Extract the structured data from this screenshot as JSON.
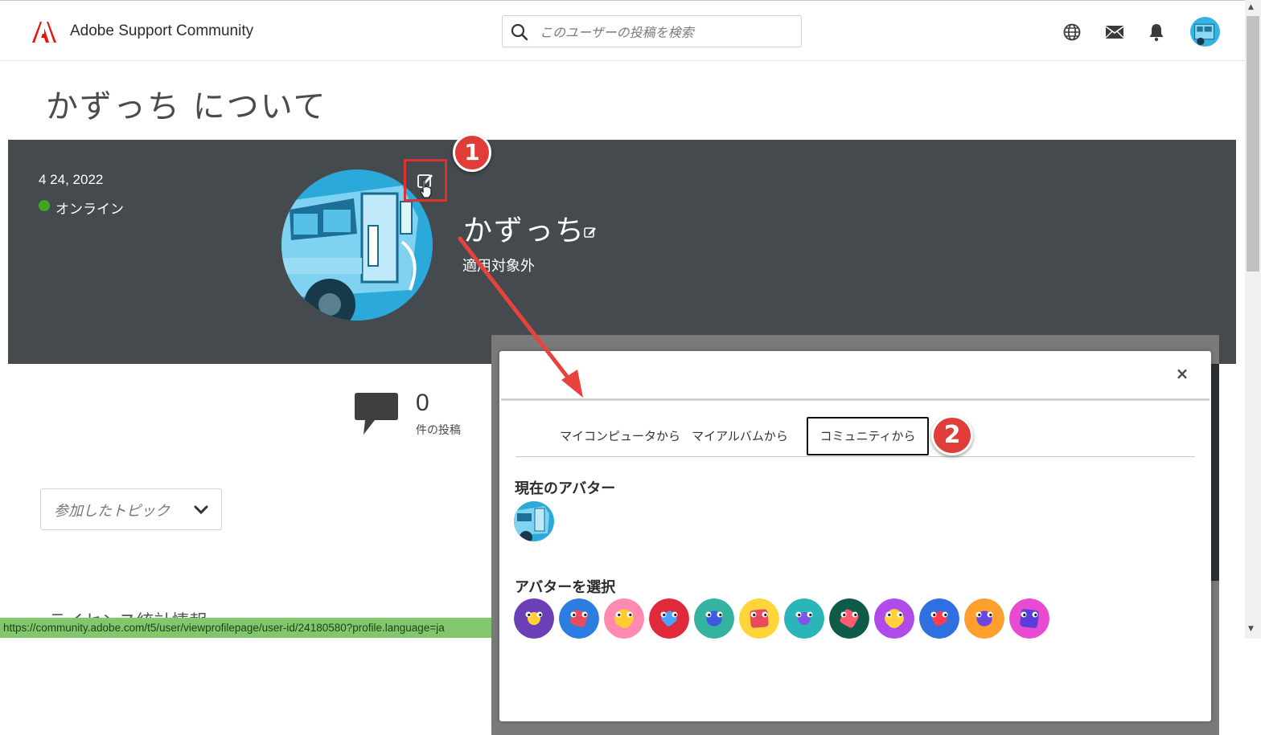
{
  "header": {
    "app_title": "Adobe Support Community",
    "search_placeholder": "このユーザーの投稿を検索"
  },
  "page": {
    "title": "かずっち について"
  },
  "profile": {
    "join_date": "4 24, 2022",
    "online_status": "オンライン",
    "name": "かずっち",
    "rank": "適用対象外"
  },
  "stats": {
    "post_count": "0",
    "post_label": "件の投稿"
  },
  "topics_select": {
    "label": "参加したトピック"
  },
  "hidden_section_heading": "ライセンス統計情報",
  "status_bar": {
    "url": "https://community.adobe.com/t5/user/viewprofilepage/user-id/24180580?profile.language=ja"
  },
  "modal": {
    "close": "×",
    "tabs": [
      "マイコンピュータから",
      "マイアルバムから",
      "コミュニティから"
    ],
    "active_tab": "コミュニティから",
    "current_avatar_title": "現在のアバター",
    "select_avatar_title": "アバターを選択"
  },
  "annotations": {
    "badge_1": "1",
    "badge_2": "2"
  },
  "colors": {
    "banner": "#454a4e",
    "online": "#3ea623",
    "annotation_red": "#e03c38",
    "adobe_red": "#eb1000"
  },
  "avatar_choices": [
    {
      "icon": "stamp-avatar",
      "bg": "#6b3fb5",
      "fg": "#ffd23a"
    },
    {
      "icon": "robot-face-avatar",
      "bg": "#2c7de0",
      "fg": "#e84b5e"
    },
    {
      "icon": "macaron-avatar",
      "bg": "#ff8ab0",
      "fg": "#ffcc33"
    },
    {
      "icon": "octopus-avatar",
      "bg": "#e02a3c",
      "fg": "#4aa3ff"
    },
    {
      "icon": "layers-avatar",
      "bg": "#33b3a0",
      "fg": "#3e5be0"
    },
    {
      "icon": "rainbow-brush-avatar",
      "bg": "#ffd53a",
      "fg": "#e84b5e"
    },
    {
      "icon": "paint-bucket-avatar",
      "bg": "#2ab5b8",
      "fg": "#7f56e3"
    },
    {
      "icon": "pen-nib-avatar",
      "bg": "#0e5b4a",
      "fg": "#ff5a6e"
    },
    {
      "icon": "pencil-avatar",
      "bg": "#b04ae8",
      "fg": "#ffd23a"
    },
    {
      "icon": "scissors-avatar",
      "bg": "#2f6fe0",
      "fg": "#ff3b4e"
    },
    {
      "icon": "cursor-avatar",
      "bg": "#ff9f2e",
      "fg": "#6a47e0"
    },
    {
      "icon": "magnifier-doc-avatar",
      "bg": "#e84bd1",
      "fg": "#5a3fd6"
    }
  ]
}
